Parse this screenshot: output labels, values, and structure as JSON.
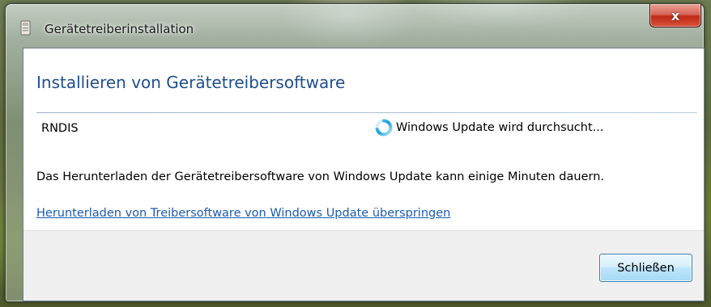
{
  "window": {
    "title": "Gerätetreiberinstallation",
    "close_glyph": "x"
  },
  "content": {
    "heading": "Installieren von Gerätetreibersoftware",
    "device_name": "RNDIS",
    "status_text": "Windows Update wird durchsucht...",
    "info_text": "Das Herunterladen der Gerätetreibersoftware von Windows Update kann einige Minuten dauern.",
    "skip_link": "Herunterladen von Treibersoftware von Windows Update überspringen"
  },
  "footer": {
    "close_button_label": "Schließen"
  },
  "icons": {
    "window_icon": "device-installer-icon",
    "status_icon": "busy-spinner-icon",
    "close_icon": "close-icon"
  },
  "colors": {
    "heading": "#1f4f8e",
    "link": "#1a5bb0",
    "close_button": "#c02a14",
    "accent_button_border": "#3c7fb1"
  }
}
